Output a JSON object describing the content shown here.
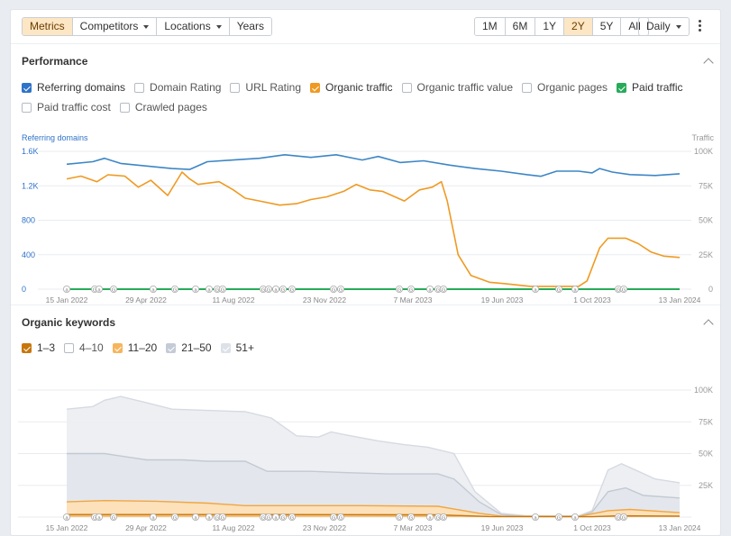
{
  "toolbar": {
    "tabs": [
      {
        "label": "Metrics",
        "active": true,
        "dropdown": false
      },
      {
        "label": "Competitors",
        "active": false,
        "dropdown": true
      },
      {
        "label": "Locations",
        "active": false,
        "dropdown": true
      },
      {
        "label": "Years",
        "active": false,
        "dropdown": false
      }
    ],
    "ranges": [
      {
        "label": "1M",
        "active": false
      },
      {
        "label": "6M",
        "active": false
      },
      {
        "label": "1Y",
        "active": false
      },
      {
        "label": "2Y",
        "active": true
      },
      {
        "label": "5Y",
        "active": false
      },
      {
        "label": "All",
        "active": false
      }
    ],
    "interval": "Daily",
    "more_icon": "kebab-icon"
  },
  "performance": {
    "title": "Performance",
    "checkboxes": [
      {
        "label": "Referring domains",
        "checked": true,
        "color": "#2f73c9"
      },
      {
        "label": "Domain Rating",
        "checked": false,
        "color": "#b5bbc4"
      },
      {
        "label": "URL Rating",
        "checked": false,
        "color": "#b5bbc4"
      },
      {
        "label": "Organic traffic",
        "checked": true,
        "color": "#ef9a22"
      },
      {
        "label": "Organic traffic value",
        "checked": false,
        "color": "#b5bbc4"
      },
      {
        "label": "Organic pages",
        "checked": false,
        "color": "#b5bbc4"
      },
      {
        "label": "Paid traffic",
        "checked": true,
        "color": "#27ab5a"
      },
      {
        "label": "Paid traffic cost",
        "checked": false,
        "color": "#b5bbc4"
      },
      {
        "label": "Crawled pages",
        "checked": false,
        "color": "#b5bbc4"
      }
    ]
  },
  "organic_keywords": {
    "title": "Organic keywords",
    "checkboxes": [
      {
        "label": "1–3",
        "checked": true,
        "color": "#c8760a"
      },
      {
        "label": "4–10",
        "checked": false,
        "color": "#b5bbc4"
      },
      {
        "label": "11–20",
        "checked": true,
        "color": "#f6b55d"
      },
      {
        "label": "21–50",
        "checked": true,
        "color": "#c5cbd6"
      },
      {
        "label": "51+",
        "checked": true,
        "color": "#dde1e8"
      }
    ]
  },
  "chart_data": [
    {
      "type": "line",
      "y_axis_left_label": "Referring domains",
      "y_axis_right_label": "Traffic",
      "x_ticks": [
        "15 Jan 2022",
        "29 Apr 2022",
        "11 Aug 2022",
        "23 Nov 2022",
        "7 Mar 2023",
        "19 Jun 2023",
        "1 Oct 2023",
        "13 Jan 2024"
      ],
      "y_left_ticks": [
        "0",
        "400",
        "800",
        "1.2K",
        "1.6K"
      ],
      "y_left_range": [
        0,
        1600
      ],
      "y_right_ticks": [
        "0",
        "25K",
        "50K",
        "75K",
        "100K"
      ],
      "y_right_range": [
        0,
        100000
      ],
      "grid": true,
      "series": [
        {
          "name": "Referring domains",
          "axis": "left",
          "color": "#3d86c6",
          "points": [
            [
              "2022-01-15",
              1450
            ],
            [
              "2022-02-15",
              1480
            ],
            [
              "2022-03-01",
              1520
            ],
            [
              "2022-03-20",
              1460
            ],
            [
              "2022-04-20",
              1430
            ],
            [
              "2022-05-20",
              1400
            ],
            [
              "2022-06-10",
              1390
            ],
            [
              "2022-07-01",
              1480
            ],
            [
              "2022-08-01",
              1500
            ],
            [
              "2022-09-01",
              1520
            ],
            [
              "2022-10-01",
              1560
            ],
            [
              "2022-11-01",
              1530
            ],
            [
              "2022-12-01",
              1560
            ],
            [
              "2023-01-01",
              1500
            ],
            [
              "2023-01-20",
              1540
            ],
            [
              "2023-02-15",
              1470
            ],
            [
              "2023-03-15",
              1490
            ],
            [
              "2023-04-15",
              1440
            ],
            [
              "2023-05-15",
              1400
            ],
            [
              "2023-06-15",
              1370
            ],
            [
              "2023-07-15",
              1330
            ],
            [
              "2023-08-01",
              1310
            ],
            [
              "2023-08-20",
              1370
            ],
            [
              "2023-09-15",
              1370
            ],
            [
              "2023-10-01",
              1350
            ],
            [
              "2023-10-10",
              1400
            ],
            [
              "2023-10-25",
              1360
            ],
            [
              "2023-11-15",
              1330
            ],
            [
              "2023-12-15",
              1320
            ],
            [
              "2024-01-13",
              1340
            ]
          ]
        },
        {
          "name": "Organic traffic",
          "axis": "right",
          "color": "#ef9a22",
          "points": [
            [
              "2022-01-15",
              80000
            ],
            [
              "2022-02-01",
              82000
            ],
            [
              "2022-02-20",
              78000
            ],
            [
              "2022-03-05",
              83000
            ],
            [
              "2022-03-25",
              82000
            ],
            [
              "2022-04-10",
              74000
            ],
            [
              "2022-04-25",
              79000
            ],
            [
              "2022-05-15",
              68000
            ],
            [
              "2022-06-01",
              85000
            ],
            [
              "2022-06-10",
              80000
            ],
            [
              "2022-06-20",
              76000
            ],
            [
              "2022-07-15",
              78000
            ],
            [
              "2022-08-01",
              72000
            ],
            [
              "2022-08-15",
              66000
            ],
            [
              "2022-09-01",
              64000
            ],
            [
              "2022-09-25",
              61000
            ],
            [
              "2022-10-15",
              62000
            ],
            [
              "2022-11-01",
              65000
            ],
            [
              "2022-11-20",
              67000
            ],
            [
              "2022-12-10",
              71000
            ],
            [
              "2022-12-25",
              76000
            ],
            [
              "2023-01-10",
              72000
            ],
            [
              "2023-01-25",
              71000
            ],
            [
              "2023-02-20",
              64000
            ],
            [
              "2023-03-10",
              72000
            ],
            [
              "2023-03-25",
              74000
            ],
            [
              "2023-04-05",
              78000
            ],
            [
              "2023-04-12",
              64000
            ],
            [
              "2023-04-25",
              25000
            ],
            [
              "2023-05-10",
              10000
            ],
            [
              "2023-06-01",
              5000
            ],
            [
              "2023-06-20",
              4000
            ],
            [
              "2023-07-20",
              2000
            ],
            [
              "2023-08-20",
              2000
            ],
            [
              "2023-09-15",
              2000
            ],
            [
              "2023-09-25",
              6000
            ],
            [
              "2023-10-10",
              30000
            ],
            [
              "2023-10-20",
              37000
            ],
            [
              "2023-11-10",
              37000
            ],
            [
              "2023-11-25",
              33000
            ],
            [
              "2023-12-10",
              27000
            ],
            [
              "2023-12-25",
              24000
            ],
            [
              "2024-01-13",
              23000
            ]
          ]
        },
        {
          "name": "Paid traffic",
          "axis": "right",
          "color": "#27ab5a",
          "points": [
            [
              "2022-01-15",
              0
            ],
            [
              "2024-01-13",
              0
            ]
          ]
        }
      ]
    },
    {
      "type": "area",
      "y_axis_right_ticks": [
        "25K",
        "50K",
        "75K",
        "100K"
      ],
      "y_range": [
        0,
        100000
      ],
      "x_ticks": [
        "15 Jan 2022",
        "29 Apr 2022",
        "11 Aug 2022",
        "23 Nov 2022",
        "7 Mar 2023",
        "19 Jun 2023",
        "1 Oct 2023",
        "13 Jan 2024"
      ],
      "grid": true,
      "stacked": true,
      "series": [
        {
          "name": "51+",
          "color": "#dde1e8",
          "points": [
            [
              "2022-01-15",
              85000
            ],
            [
              "2022-02-15",
              87000
            ],
            [
              "2022-03-01",
              92000
            ],
            [
              "2022-03-20",
              95000
            ],
            [
              "2022-04-20",
              90000
            ],
            [
              "2022-05-20",
              85000
            ],
            [
              "2022-07-01",
              84000
            ],
            [
              "2022-08-15",
              83000
            ],
            [
              "2022-09-15",
              78000
            ],
            [
              "2022-10-15",
              64000
            ],
            [
              "2022-11-10",
              63000
            ],
            [
              "2022-11-25",
              67000
            ],
            [
              "2022-12-10",
              65000
            ],
            [
              "2023-01-20",
              60000
            ],
            [
              "2023-02-20",
              57000
            ],
            [
              "2023-03-20",
              55000
            ],
            [
              "2023-04-20",
              50000
            ],
            [
              "2023-05-15",
              20000
            ],
            [
              "2023-06-15",
              3000
            ],
            [
              "2023-07-15",
              1000
            ],
            [
              "2023-09-15",
              1000
            ],
            [
              "2023-10-01",
              5000
            ],
            [
              "2023-10-20",
              37000
            ],
            [
              "2023-11-05",
              42000
            ],
            [
              "2023-11-25",
              36000
            ],
            [
              "2023-12-15",
              30000
            ],
            [
              "2024-01-13",
              27000
            ]
          ]
        },
        {
          "name": "21–50",
          "color": "#c5cbd6",
          "points": [
            [
              "2022-01-15",
              50000
            ],
            [
              "2022-03-01",
              50000
            ],
            [
              "2022-04-20",
              45000
            ],
            [
              "2022-06-01",
              45000
            ],
            [
              "2022-07-01",
              44000
            ],
            [
              "2022-08-15",
              44000
            ],
            [
              "2022-09-10",
              36000
            ],
            [
              "2022-11-01",
              36000
            ],
            [
              "2022-12-15",
              35000
            ],
            [
              "2023-02-01",
              34000
            ],
            [
              "2023-04-01",
              34000
            ],
            [
              "2023-04-20",
              30000
            ],
            [
              "2023-05-20",
              12000
            ],
            [
              "2023-06-15",
              2000
            ],
            [
              "2023-07-15",
              500
            ],
            [
              "2023-09-15",
              500
            ],
            [
              "2023-10-01",
              4000
            ],
            [
              "2023-10-20",
              20000
            ],
            [
              "2023-11-10",
              23000
            ],
            [
              "2023-12-01",
              17000
            ],
            [
              "2024-01-13",
              15000
            ]
          ]
        },
        {
          "name": "11–20",
          "color": "#f6b55d",
          "points": [
            [
              "2022-01-15",
              12000
            ],
            [
              "2022-03-01",
              13000
            ],
            [
              "2022-05-01",
              12500
            ],
            [
              "2022-07-01",
              11000
            ],
            [
              "2022-08-15",
              9000
            ],
            [
              "2022-10-01",
              9000
            ],
            [
              "2023-01-01",
              9000
            ],
            [
              "2023-04-01",
              8500
            ],
            [
              "2023-05-20",
              3000
            ],
            [
              "2023-06-15",
              800
            ],
            [
              "2023-09-15",
              500
            ],
            [
              "2023-10-20",
              5000
            ],
            [
              "2023-11-15",
              6000
            ],
            [
              "2024-01-13",
              3500
            ]
          ]
        },
        {
          "name": "1–3",
          "color": "#c8760a",
          "points": [
            [
              "2022-01-15",
              2000
            ],
            [
              "2022-09-01",
              2000
            ],
            [
              "2023-04-01",
              1800
            ],
            [
              "2023-06-01",
              400
            ],
            [
              "2023-10-01",
              300
            ],
            [
              "2023-11-01",
              1000
            ],
            [
              "2024-01-13",
              800
            ]
          ]
        }
      ]
    }
  ],
  "annotation_marker_labels": [
    "a",
    "G"
  ]
}
